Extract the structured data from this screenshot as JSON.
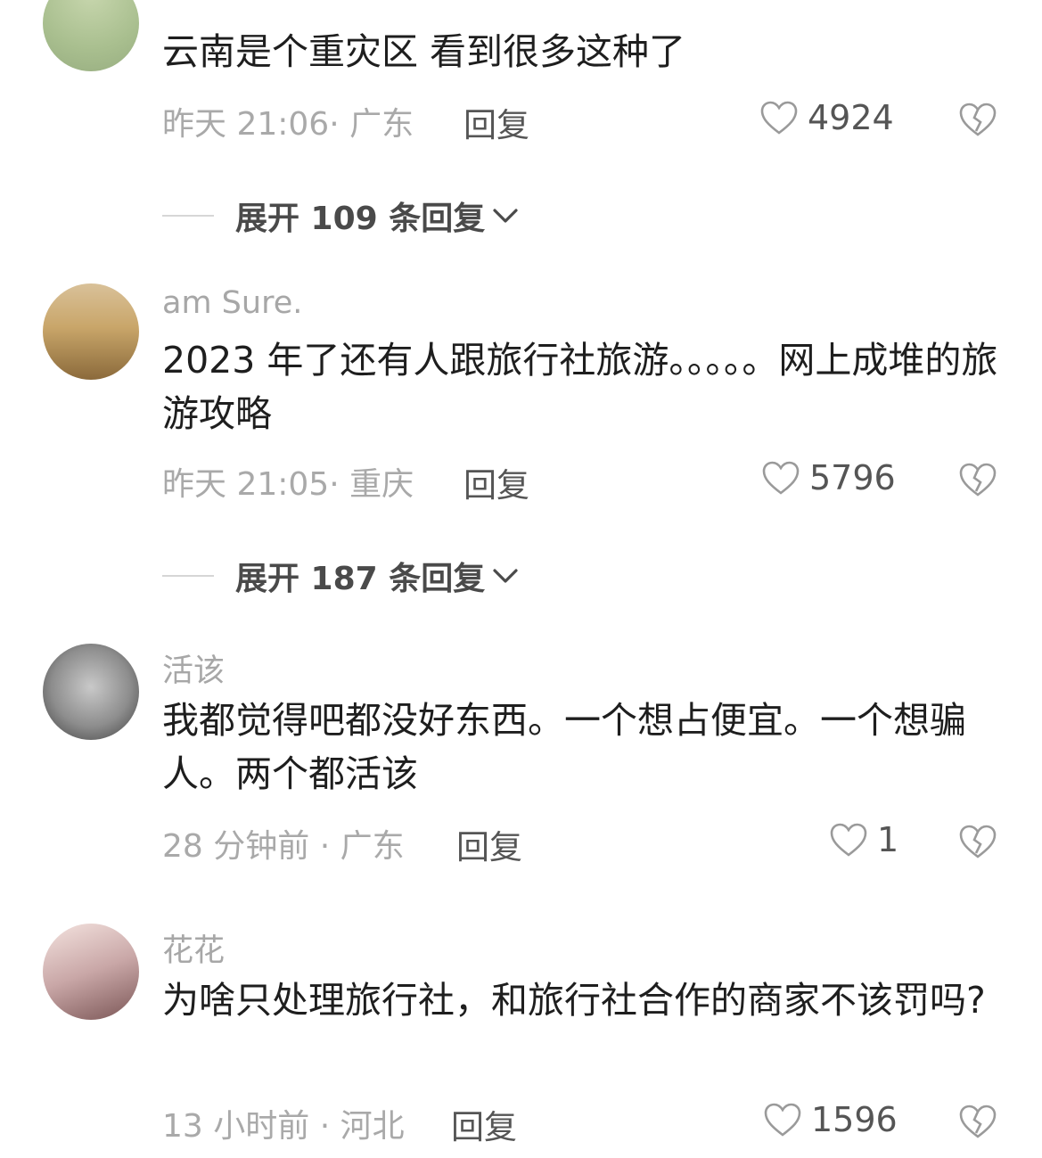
{
  "comments": [
    {
      "username": "",
      "text": "云南是个重灾区 看到很多这种了",
      "time_location": "昨天 21:06· 广东",
      "reply_label": "回复",
      "likes": "4924",
      "expand_label": "展开 109 条回复"
    },
    {
      "username": "am Sure.",
      "text": "2023 年了还有人跟旅行社旅游。。。。。网上成堆的旅游攻略",
      "time_location": "昨天 21:05· 重庆",
      "reply_label": "回复",
      "likes": "5796",
      "expand_label": "展开 187 条回复"
    },
    {
      "username": "活该",
      "text": "我都觉得吧都没好东西。一个想占便宜。一个想骗人。两个都活该",
      "time_location": "28 分钟前 · 广东",
      "reply_label": "回复",
      "likes": "1"
    },
    {
      "username": "花花",
      "text": "为啥只处理旅行社，和旅行社合作的商家不该罚吗?",
      "time_location": "13 小时前 · 河北",
      "reply_label": "回复",
      "likes": "1596"
    }
  ]
}
